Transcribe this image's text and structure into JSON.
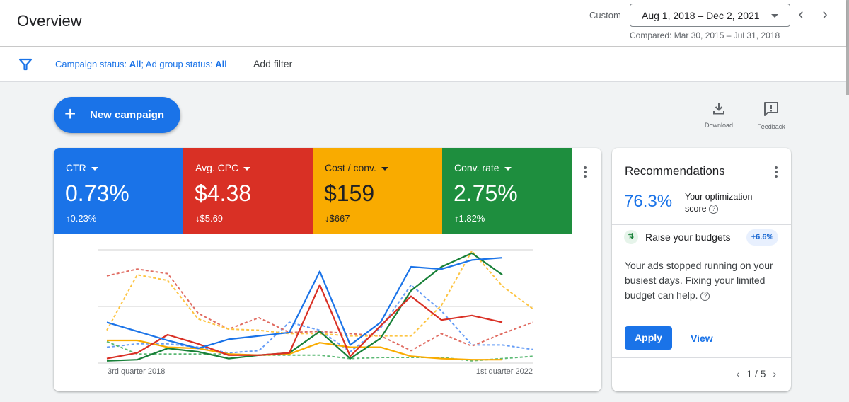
{
  "header": {
    "title": "Overview",
    "date_range_label": "Custom",
    "date_range": "Aug 1, 2018 – Dec 2, 2021",
    "compared": "Compared: Mar 30, 2015 – Jul 31, 2018",
    "prev_icon": "‹",
    "next_icon": "›"
  },
  "filters": {
    "campaign_status_label": "Campaign status: ",
    "campaign_status_value": "All",
    "separator": "; ",
    "ad_group_status_label": "Ad group status: ",
    "ad_group_status_value": "All",
    "add_filter": "Add filter"
  },
  "actions": {
    "new_campaign": "New campaign",
    "download": "Download",
    "feedback": "Feedback"
  },
  "metrics": [
    {
      "name": "CTR",
      "value": "0.73%",
      "delta_arrow": "↑",
      "delta": "0.23%",
      "color": "#1a73e8",
      "text_color": "#ffffff"
    },
    {
      "name": "Avg. CPC",
      "value": "$4.38",
      "delta_arrow": "↓",
      "delta": "$5.69",
      "color": "#d93025",
      "text_color": "#ffffff"
    },
    {
      "name": "Cost / conv.",
      "value": "$159",
      "delta_arrow": "↓",
      "delta": "$667",
      "color": "#f9ab00",
      "text_color": "#202124"
    },
    {
      "name": "Conv. rate",
      "value": "2.75%",
      "delta_arrow": "↑",
      "delta": "1.82%",
      "color": "#1e8e3e",
      "text_color": "#ffffff"
    }
  ],
  "chart_data": {
    "type": "line",
    "xlabel_start": "3rd quarter 2018",
    "xlabel_end": "1st quarter 2022",
    "ylim": [
      0,
      100
    ],
    "grid": true,
    "points": 15,
    "series": [
      {
        "name": "CTR (compared)",
        "color": "#669df6",
        "dashed": true,
        "values": [
          14,
          17,
          17,
          14,
          9,
          11,
          36,
          29,
          10,
          31,
          69,
          46,
          16,
          16,
          12
        ]
      },
      {
        "name": "Avg. CPC (compared)",
        "color": "#e06c62",
        "dashed": true,
        "values": [
          77,
          83,
          79,
          44,
          30,
          40,
          27,
          28,
          26,
          24,
          11,
          26,
          15,
          26,
          36
        ]
      },
      {
        "name": "Cost / conv. (compared)",
        "color": "#fdc442",
        "dashed": true,
        "values": [
          29,
          78,
          73,
          39,
          30,
          29,
          26,
          26,
          24,
          24,
          24,
          51,
          99,
          68,
          48
        ]
      },
      {
        "name": "Conv. rate (compared)",
        "color": "#5bb974",
        "dashed": true,
        "values": [
          19,
          8,
          8,
          8,
          8,
          7,
          7,
          7,
          4,
          5,
          5,
          5,
          2,
          4,
          6
        ]
      },
      {
        "name": "Cost / conv.",
        "color": "#f9ab00",
        "dashed": false,
        "values": [
          20,
          20,
          14,
          13,
          8,
          7,
          8,
          18,
          14,
          14,
          6,
          4,
          3,
          3
        ]
      },
      {
        "name": "Conv. rate",
        "color": "#188038",
        "dashed": false,
        "values": [
          2,
          3,
          13,
          10,
          4,
          7,
          9,
          28,
          4,
          22,
          64,
          85,
          97,
          78
        ]
      },
      {
        "name": "Avg. CPC",
        "color": "#d93025",
        "dashed": false,
        "values": [
          4,
          9,
          25,
          17,
          7,
          7,
          9,
          69,
          6,
          33,
          59,
          38,
          42,
          36
        ]
      },
      {
        "name": "CTR",
        "color": "#1a73e8",
        "dashed": false,
        "values": [
          36,
          28,
          20,
          13,
          21,
          24,
          27,
          81,
          16,
          36,
          85,
          83,
          91,
          93
        ]
      }
    ]
  },
  "recommendations": {
    "title": "Recommendations",
    "score": "76.3%",
    "score_label": "Your optimization score",
    "score_label_line1": "Your optimization",
    "score_label_line2": "score",
    "help_glyph": "?",
    "budget_icon_glyph": "⇅",
    "item_title": "Raise your budgets",
    "item_badge": "+6.6%",
    "item_description": "Your ads stopped running on your busiest days. Fixing your limited budget can help.",
    "apply": "Apply",
    "view": "View",
    "pager_prev": "‹",
    "pager_next": "›",
    "page": "1 / 5"
  }
}
